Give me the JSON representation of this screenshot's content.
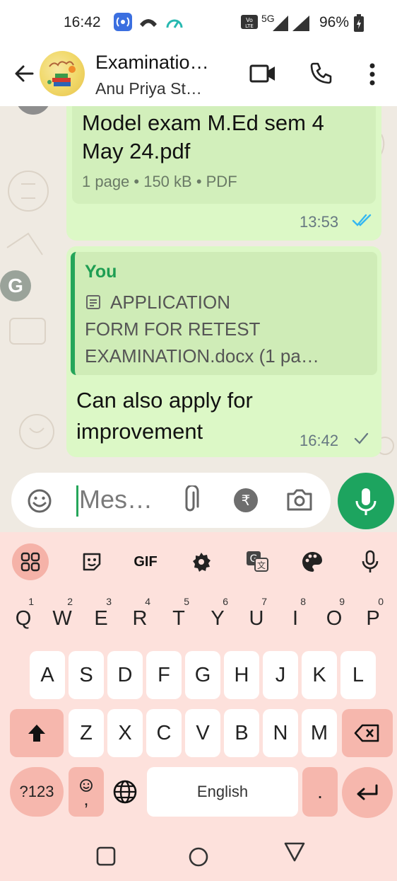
{
  "status_bar": {
    "time": "16:42",
    "network": "5G",
    "battery_percent": "96%"
  },
  "header": {
    "title": "Examinatio…",
    "subtitle": "Anu Priya St…",
    "icons": [
      "back-arrow-icon",
      "group-avatar",
      "video-call-icon",
      "voice-call-icon",
      "more-options-icon"
    ]
  },
  "chat": {
    "messages": [
      {
        "type": "document",
        "file_name_line1": "Model exam M.Ed sem 4",
        "file_name_line2": "May 24.pdf",
        "meta": "1 page • 150 kB • PDF",
        "time": "13:53",
        "status": "read"
      },
      {
        "type": "reply",
        "quoted_author": "You",
        "quoted_line1": "APPLICATION",
        "quoted_line2": "FORM FOR RETEST",
        "quoted_line3": "EXAMINATION.docx (1 pa…",
        "text_line1": "Can also apply for",
        "text_line2": "improvement",
        "time": "16:42",
        "status": "sent"
      }
    ],
    "badge_letter": "G"
  },
  "composer": {
    "placeholder": "Mes…",
    "icons": [
      "emoji-icon",
      "attach-icon",
      "rupee-payment-icon",
      "camera-icon",
      "microphone-icon"
    ]
  },
  "keyboard": {
    "toolbar_icons": [
      "apps-grid-icon",
      "sticker-icon",
      "gif-icon",
      "settings-gear-icon",
      "translate-icon",
      "palette-icon",
      "voice-input-icon"
    ],
    "gif_label": "GIF",
    "row1": [
      {
        "key": "Q",
        "alt": "1"
      },
      {
        "key": "W",
        "alt": "2"
      },
      {
        "key": "E",
        "alt": "3"
      },
      {
        "key": "R",
        "alt": "4"
      },
      {
        "key": "T",
        "alt": "5"
      },
      {
        "key": "Y",
        "alt": "6"
      },
      {
        "key": "U",
        "alt": "7"
      },
      {
        "key": "I",
        "alt": "8"
      },
      {
        "key": "O",
        "alt": "9"
      },
      {
        "key": "P",
        "alt": "0"
      }
    ],
    "row2": [
      "A",
      "S",
      "D",
      "F",
      "G",
      "H",
      "J",
      "K",
      "L"
    ],
    "row3": [
      "Z",
      "X",
      "C",
      "V",
      "B",
      "N",
      "M"
    ],
    "symbols_label": "?123",
    "emoji_comma": ",",
    "space_label": "English",
    "period_label": "."
  },
  "nav_bar": {
    "icons": [
      "recents-square-icon",
      "home-circle-icon",
      "back-triangle-icon"
    ]
  },
  "colors": {
    "bubble": "#dcf8c6",
    "accent_green": "#1da45f",
    "keyboard_bg": "#fde1dc",
    "keyboard_accent": "#f6b7ad",
    "read_tick": "#34b7f1"
  }
}
